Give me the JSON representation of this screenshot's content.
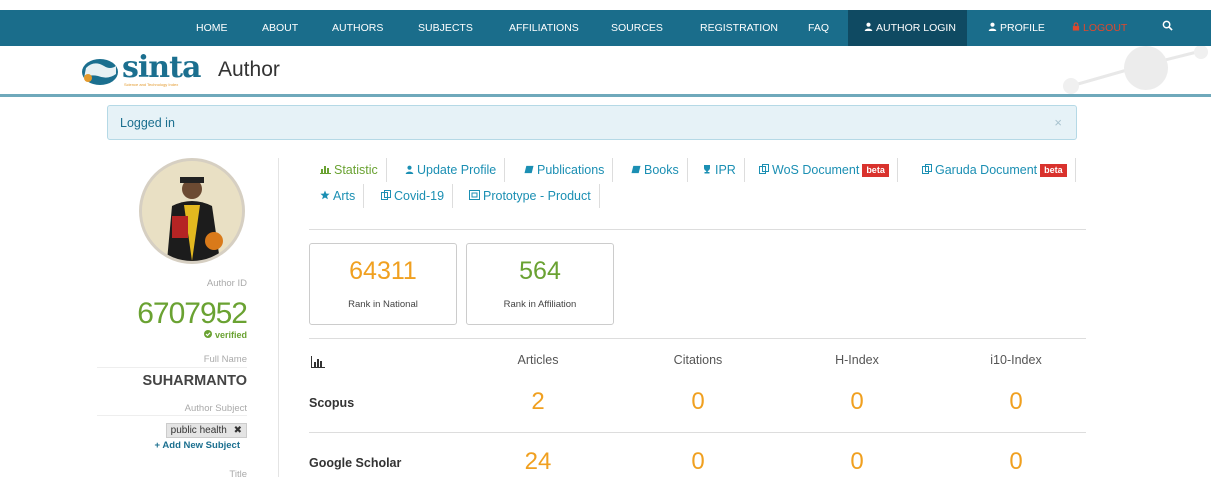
{
  "nav": {
    "home": "HOME",
    "about": "ABOUT",
    "authors": "AUTHORS",
    "subjects": "SUBJECTS",
    "affiliations": "AFFILIATIONS",
    "sources": "SOURCES",
    "registration": "REGISTRATION",
    "faq": "FAQ",
    "author_login": "AUTHOR LOGIN",
    "profile": "PROFILE",
    "logout": "LOGOUT"
  },
  "header": {
    "logo": "sinta",
    "logo_tagline": "Science and Technology Index",
    "title": "Author"
  },
  "alert": {
    "text": "Logged in",
    "close": "×"
  },
  "author": {
    "id_label": "Author ID",
    "id": "6707952",
    "verified": "verified",
    "fullname_label": "Full Name",
    "fullname": "SUHARMANTO",
    "subject_label": "Author Subject",
    "subject": "public health",
    "add_subject": "Add New Subject",
    "title_label": "Title"
  },
  "tabs": {
    "statistic": "Statistic",
    "update_profile": "Update Profile",
    "publications": "Publications",
    "books": "Books",
    "ipr": "IPR",
    "wos": "WoS Document",
    "garuda": "Garuda Document",
    "beta": "beta",
    "arts": "Arts",
    "covid": "Covid-19",
    "prototype": "Prototype - Product"
  },
  "ranks": {
    "national": {
      "value": "64311",
      "label": "Rank in National"
    },
    "affiliation": {
      "value": "564",
      "label": "Rank in Affiliation"
    }
  },
  "stats": {
    "headers": {
      "articles": "Articles",
      "citations": "Citations",
      "hindex": "H-Index",
      "i10": "i10-Index"
    },
    "scopus": {
      "label": "Scopus",
      "articles": "2",
      "citations": "0",
      "hindex": "0",
      "i10": "0"
    },
    "scholar": {
      "label": "Google Scholar",
      "articles": "24",
      "citations": "0",
      "hindex": "0",
      "i10": "0"
    }
  },
  "colors": {
    "navbar": "#1a6d8b",
    "nav_active": "#0f4a62",
    "accent_orange": "#f0a020",
    "accent_green": "#6aa232",
    "link_blue": "#1b8fb3",
    "logout_red": "#e0482d",
    "beta_red": "#d9322d"
  },
  "icons": [
    "user-icon",
    "lock-icon",
    "search-icon",
    "bar-chart-icon",
    "book-icon",
    "trophy-icon",
    "copy-icon",
    "star-icon",
    "check-circle-icon",
    "plus-icon",
    "close-icon"
  ]
}
